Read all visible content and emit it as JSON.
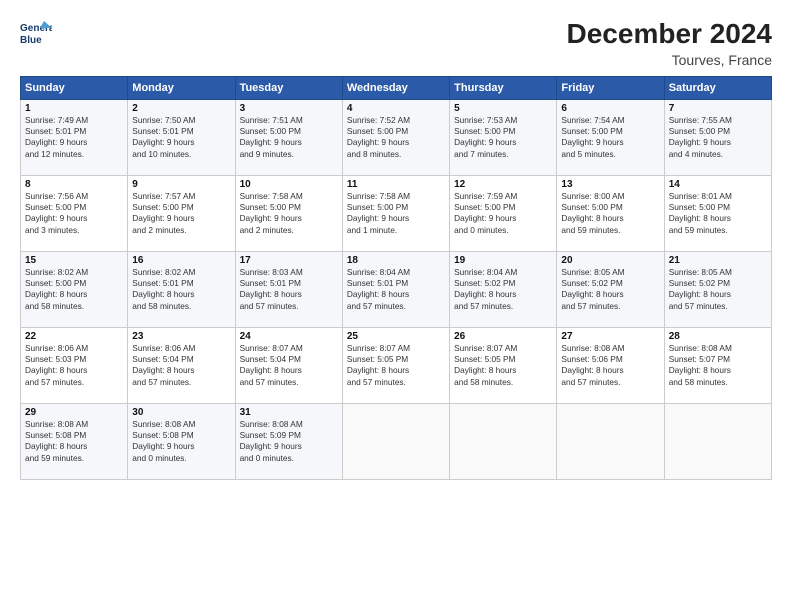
{
  "header": {
    "logo_line1": "General",
    "logo_line2": "Blue",
    "title": "December 2024",
    "subtitle": "Tourves, France"
  },
  "days_of_week": [
    "Sunday",
    "Monday",
    "Tuesday",
    "Wednesday",
    "Thursday",
    "Friday",
    "Saturday"
  ],
  "weeks": [
    [
      {
        "day": "1",
        "info": "Sunrise: 7:49 AM\nSunset: 5:01 PM\nDaylight: 9 hours\nand 12 minutes."
      },
      {
        "day": "2",
        "info": "Sunrise: 7:50 AM\nSunset: 5:01 PM\nDaylight: 9 hours\nand 10 minutes."
      },
      {
        "day": "3",
        "info": "Sunrise: 7:51 AM\nSunset: 5:00 PM\nDaylight: 9 hours\nand 9 minutes."
      },
      {
        "day": "4",
        "info": "Sunrise: 7:52 AM\nSunset: 5:00 PM\nDaylight: 9 hours\nand 8 minutes."
      },
      {
        "day": "5",
        "info": "Sunrise: 7:53 AM\nSunset: 5:00 PM\nDaylight: 9 hours\nand 7 minutes."
      },
      {
        "day": "6",
        "info": "Sunrise: 7:54 AM\nSunset: 5:00 PM\nDaylight: 9 hours\nand 5 minutes."
      },
      {
        "day": "7",
        "info": "Sunrise: 7:55 AM\nSunset: 5:00 PM\nDaylight: 9 hours\nand 4 minutes."
      }
    ],
    [
      {
        "day": "8",
        "info": "Sunrise: 7:56 AM\nSunset: 5:00 PM\nDaylight: 9 hours\nand 3 minutes."
      },
      {
        "day": "9",
        "info": "Sunrise: 7:57 AM\nSunset: 5:00 PM\nDaylight: 9 hours\nand 2 minutes."
      },
      {
        "day": "10",
        "info": "Sunrise: 7:58 AM\nSunset: 5:00 PM\nDaylight: 9 hours\nand 2 minutes."
      },
      {
        "day": "11",
        "info": "Sunrise: 7:58 AM\nSunset: 5:00 PM\nDaylight: 9 hours\nand 1 minute."
      },
      {
        "day": "12",
        "info": "Sunrise: 7:59 AM\nSunset: 5:00 PM\nDaylight: 9 hours\nand 0 minutes."
      },
      {
        "day": "13",
        "info": "Sunrise: 8:00 AM\nSunset: 5:00 PM\nDaylight: 8 hours\nand 59 minutes."
      },
      {
        "day": "14",
        "info": "Sunrise: 8:01 AM\nSunset: 5:00 PM\nDaylight: 8 hours\nand 59 minutes."
      }
    ],
    [
      {
        "day": "15",
        "info": "Sunrise: 8:02 AM\nSunset: 5:00 PM\nDaylight: 8 hours\nand 58 minutes."
      },
      {
        "day": "16",
        "info": "Sunrise: 8:02 AM\nSunset: 5:01 PM\nDaylight: 8 hours\nand 58 minutes."
      },
      {
        "day": "17",
        "info": "Sunrise: 8:03 AM\nSunset: 5:01 PM\nDaylight: 8 hours\nand 57 minutes."
      },
      {
        "day": "18",
        "info": "Sunrise: 8:04 AM\nSunset: 5:01 PM\nDaylight: 8 hours\nand 57 minutes."
      },
      {
        "day": "19",
        "info": "Sunrise: 8:04 AM\nSunset: 5:02 PM\nDaylight: 8 hours\nand 57 minutes."
      },
      {
        "day": "20",
        "info": "Sunrise: 8:05 AM\nSunset: 5:02 PM\nDaylight: 8 hours\nand 57 minutes."
      },
      {
        "day": "21",
        "info": "Sunrise: 8:05 AM\nSunset: 5:02 PM\nDaylight: 8 hours\nand 57 minutes."
      }
    ],
    [
      {
        "day": "22",
        "info": "Sunrise: 8:06 AM\nSunset: 5:03 PM\nDaylight: 8 hours\nand 57 minutes."
      },
      {
        "day": "23",
        "info": "Sunrise: 8:06 AM\nSunset: 5:04 PM\nDaylight: 8 hours\nand 57 minutes."
      },
      {
        "day": "24",
        "info": "Sunrise: 8:07 AM\nSunset: 5:04 PM\nDaylight: 8 hours\nand 57 minutes."
      },
      {
        "day": "25",
        "info": "Sunrise: 8:07 AM\nSunset: 5:05 PM\nDaylight: 8 hours\nand 57 minutes."
      },
      {
        "day": "26",
        "info": "Sunrise: 8:07 AM\nSunset: 5:05 PM\nDaylight: 8 hours\nand 58 minutes."
      },
      {
        "day": "27",
        "info": "Sunrise: 8:08 AM\nSunset: 5:06 PM\nDaylight: 8 hours\nand 57 minutes."
      },
      {
        "day": "28",
        "info": "Sunrise: 8:08 AM\nSunset: 5:07 PM\nDaylight: 8 hours\nand 58 minutes."
      }
    ],
    [
      {
        "day": "29",
        "info": "Sunrise: 8:08 AM\nSunset: 5:08 PM\nDaylight: 8 hours\nand 59 minutes."
      },
      {
        "day": "30",
        "info": "Sunrise: 8:08 AM\nSunset: 5:08 PM\nDaylight: 9 hours\nand 0 minutes."
      },
      {
        "day": "31",
        "info": "Sunrise: 8:08 AM\nSunset: 5:09 PM\nDaylight: 9 hours\nand 0 minutes."
      },
      {
        "day": "",
        "info": ""
      },
      {
        "day": "",
        "info": ""
      },
      {
        "day": "",
        "info": ""
      },
      {
        "day": "",
        "info": ""
      }
    ]
  ]
}
